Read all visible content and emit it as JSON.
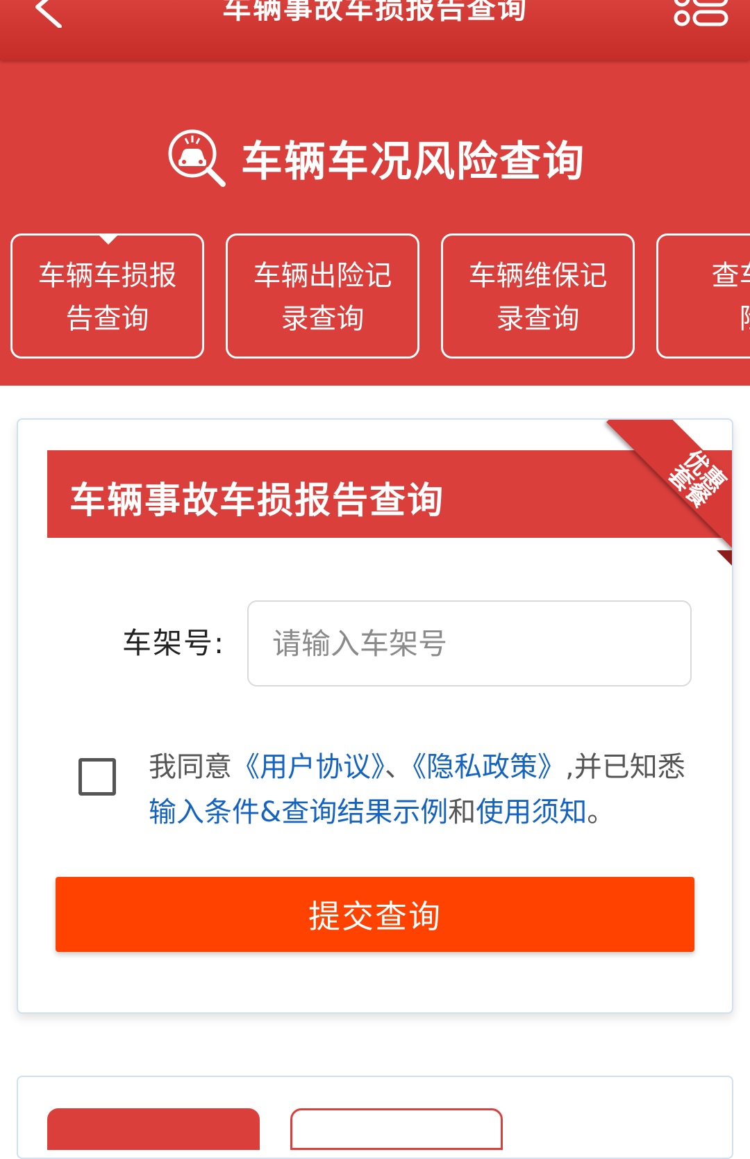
{
  "navbar": {
    "title": "车辆事故车损报告查询",
    "back_icon": "back-arrow-icon",
    "menu_icon": "menu-icon"
  },
  "banner": {
    "title": "车辆车况风险查询",
    "icon": "car-search-icon",
    "tabs": [
      {
        "line1": "车辆车损报",
        "line2": "告查询",
        "selected": true
      },
      {
        "line1": "车辆出险记",
        "line2": "录查询",
        "selected": false
      },
      {
        "line1": "车辆维保记",
        "line2": "录查询",
        "selected": false
      },
      {
        "line1": "查车辆",
        "line2": "险",
        "selected": false
      }
    ]
  },
  "card": {
    "title": "车辆事故车损报告查询",
    "ribbon": {
      "line1": "优惠",
      "line2": "套餐"
    },
    "vin": {
      "label": "车架号:",
      "placeholder": "请输入车架号",
      "value": ""
    },
    "agreement": {
      "checked": false,
      "prefix": "我同意",
      "user_agreement": "《用户协议》",
      "separator": "、",
      "privacy_policy": "《隐私政策》",
      "middle": ",并已知悉",
      "examples": "输入条件&查询结果示例",
      "and": "和",
      "usage_notes": "使用须知",
      "suffix": "。"
    },
    "submit_label": "提交查询"
  },
  "colors": {
    "primary_red": "#da3f3b",
    "submit_orange": "#ff4200",
    "link_blue": "#1463c2"
  }
}
